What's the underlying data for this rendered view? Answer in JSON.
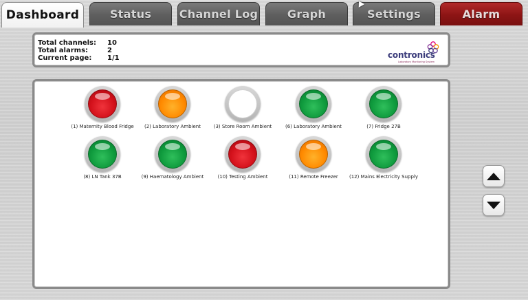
{
  "tabs": [
    {
      "label": "Dashboard"
    },
    {
      "label": "Status"
    },
    {
      "label": "Channel Log"
    },
    {
      "label": "Graph"
    },
    {
      "label": "Settings"
    },
    {
      "label": "Alarm"
    }
  ],
  "summary": {
    "total_channels_label": "Total channels:",
    "total_channels_value": "10",
    "total_alarms_label": "Total alarms:",
    "total_alarms_value": "2",
    "current_page_label": "Current page:",
    "current_page_value": "1/1"
  },
  "logo": {
    "name": "contronics",
    "tagline": "Laboratory Monitoring System"
  },
  "channels": [
    {
      "label": "(1) Maternity Blood Fridge",
      "status": "red"
    },
    {
      "label": "(2) Laboratory Ambient",
      "status": "orange"
    },
    {
      "label": "(3) Store Room Ambient",
      "status": "white"
    },
    {
      "label": "(6) Laboratory Ambient",
      "status": "green"
    },
    {
      "label": "(7) Fridge 27B",
      "status": "green"
    },
    {
      "label": "(8) LN Tank 37B",
      "status": "green"
    },
    {
      "label": "(9) Haematology Ambient",
      "status": "green"
    },
    {
      "label": "(10) Testing Ambient",
      "status": "red"
    },
    {
      "label": "(11) Remote Freezer",
      "status": "orange"
    },
    {
      "label": "(12) Mains Electricity Supply",
      "status": "green"
    }
  ],
  "controls": {
    "scroll_up_icon": "triangle-up-icon",
    "scroll_down_icon": "triangle-down-icon"
  },
  "colors": {
    "red": "#d3111b",
    "orange": "#ff8a00",
    "green": "#0f9a3d",
    "alarm_tab": "#8c1414",
    "logo_text": "#3b3c7b"
  }
}
